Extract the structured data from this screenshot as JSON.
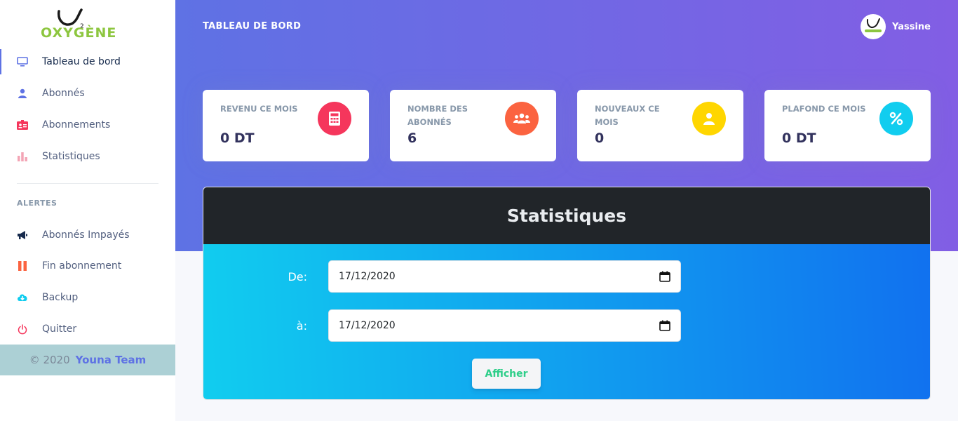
{
  "brand": {
    "logo_text": "OXYGÈNE"
  },
  "sidebar": {
    "items": [
      {
        "label": "Tableau de bord",
        "icon": "monitor-icon",
        "color": "#5e72e4",
        "active": true
      },
      {
        "label": "Abonnés",
        "icon": "user-icon",
        "color": "#5e72e4"
      },
      {
        "label": "Abonnements",
        "icon": "id-card-icon",
        "color": "#f5365c"
      },
      {
        "label": "Statistiques",
        "icon": "bar-chart-icon",
        "color": "#f3a4b5"
      }
    ],
    "section_title": "ALERTES",
    "alerts": [
      {
        "label": "Abonnés Impayés",
        "icon": "megaphone-icon",
        "color": "#172b4d"
      },
      {
        "label": "Fin abonnement",
        "icon": "pause-icon",
        "color": "#fb6340"
      },
      {
        "label": "Backup",
        "icon": "cloud-download-icon",
        "color": "#11cdef"
      },
      {
        "label": "Quitter",
        "icon": "power-icon",
        "color": "#f5365c"
      }
    ],
    "footer": {
      "copyright": "© 2020",
      "team": "Youna Team"
    }
  },
  "header": {
    "title": "TABLEAU DE BORD",
    "user_name": "Yassine"
  },
  "cards": [
    {
      "title": "REVENU CE MOIS",
      "value": "0 DT",
      "icon": "calculator-icon",
      "color": "#f5365c"
    },
    {
      "title": "NOMBRE DES ABONNÉS",
      "value": "6",
      "icon": "users-icon",
      "color": "#fb6340"
    },
    {
      "title": "NOUVEAUX CE MOIS",
      "value": "0",
      "icon": "user-icon",
      "color": "#ffd600"
    },
    {
      "title": "PLAFOND CE MOIS",
      "value": "0 DT",
      "icon": "percent-icon",
      "color": "#11cdef"
    }
  ],
  "stats": {
    "title": "Statistiques",
    "from_label": "De:",
    "from_value": "17/12/2020",
    "to_label": "à:",
    "to_value": "17/12/2020",
    "button": "Afficher"
  }
}
